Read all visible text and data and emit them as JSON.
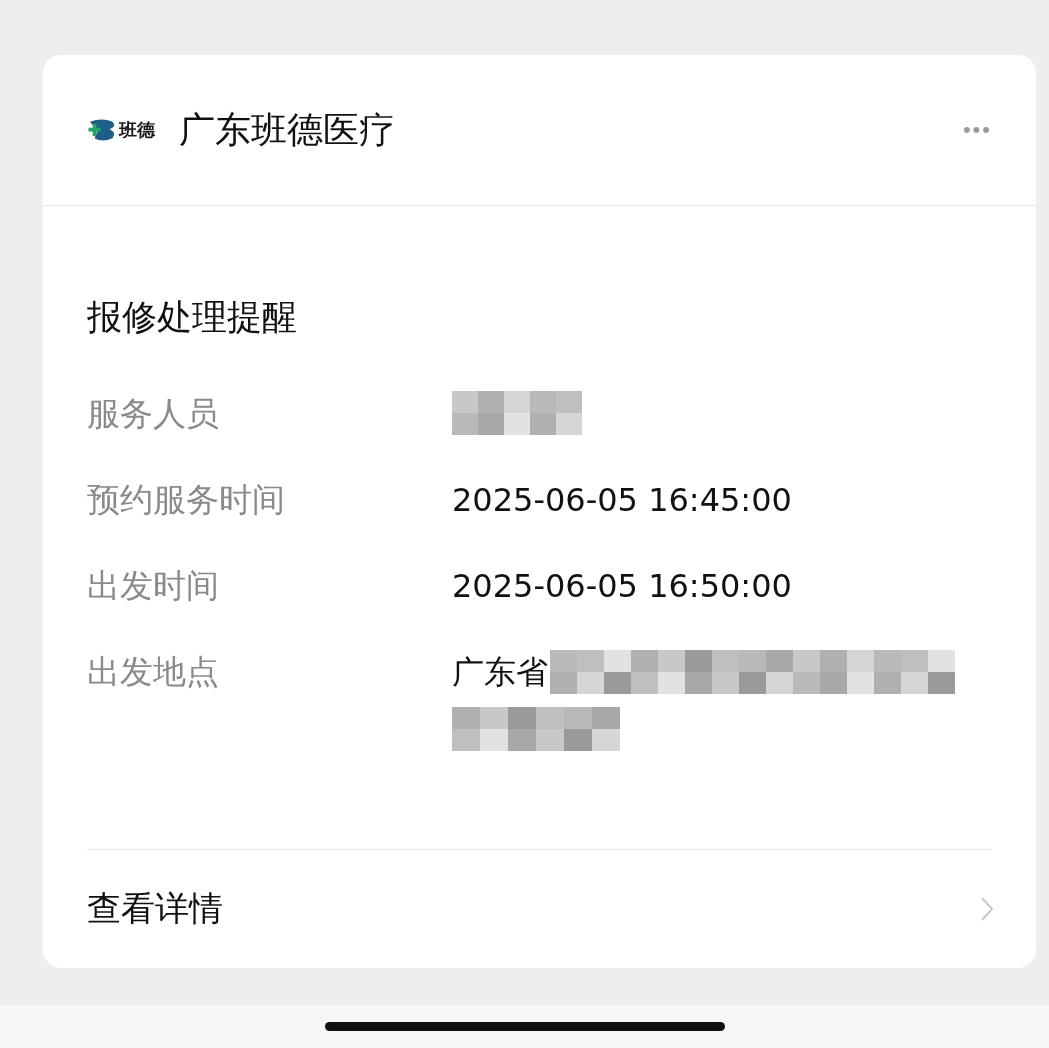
{
  "card": {
    "logo_text": "班德",
    "title": "广东班德医疗",
    "more": "•••"
  },
  "message": {
    "title": "报修处理提醒",
    "fields": [
      {
        "label": "服务人员",
        "redacted": true
      },
      {
        "label": "预约服务时间",
        "value": "2025-06-05 16:45:00",
        "redacted": false
      },
      {
        "label": "出发时间",
        "value": "2025-06-05 16:50:00",
        "redacted": false
      },
      {
        "label": "出发地点",
        "value": "广东省",
        "redacted": true
      }
    ]
  },
  "footer": {
    "link": "查看详情"
  }
}
